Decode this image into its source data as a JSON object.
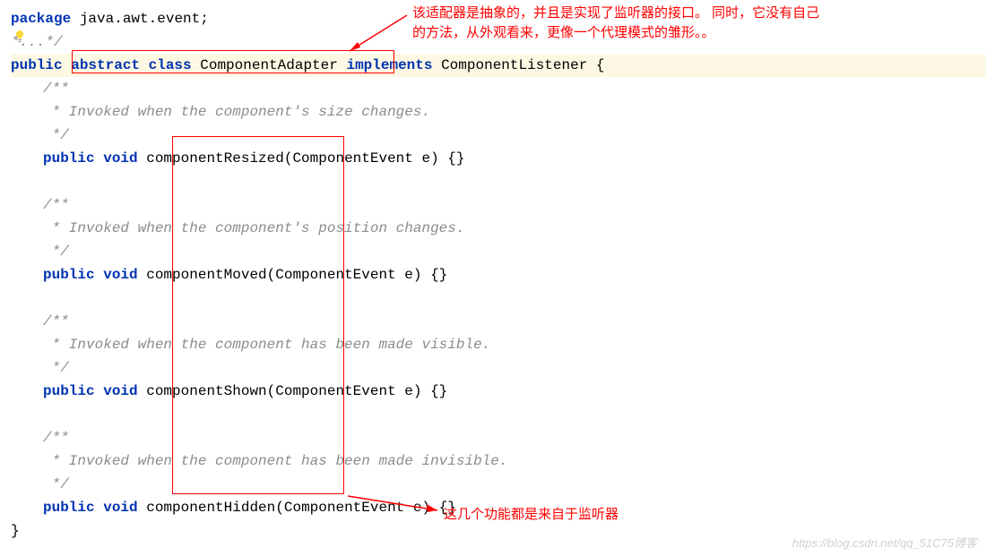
{
  "code": {
    "l1a": "package",
    "l1b": " java.awt.event;",
    "l2a": "*...*/",
    "l3a": "public",
    "l3b": " abstract class ",
    "l3c": "ComponentAdapter",
    "l3d": " implements ",
    "l3e": "ComponentListener",
    "l3f": " {",
    "c1a": "/**",
    "c1b": " * Invoked when the component's size changes.",
    "c1c": " */",
    "m1a": "public void",
    "m1b": " componentResized(",
    "m1c": "ComponentEvent",
    "m1d": " e) {}",
    "c2a": "/**",
    "c2b": " * Invoked when the component's position changes.",
    "c2c": " */",
    "m2a": "public void",
    "m2b": " componentMoved(",
    "m2c": "ComponentEvent",
    "m2d": " e) {}",
    "c3a": "/**",
    "c3b": " * Invoked when the component has been made visible.",
    "c3c": " */",
    "m3a": "public void",
    "m3b": " componentShown(",
    "m3c": "ComponentEvent",
    "m3d": " e) {}",
    "c4a": "/**",
    "c4b": " * Invoked when the component has been made invisible.",
    "c4c": " */",
    "m4a": "public void",
    "m4b": " componentHidden(",
    "m4c": "ComponentEvent",
    "m4d": " e) {}",
    "end": "}"
  },
  "annotations": {
    "top1": "该适配器是抽象的，并且是实现了监听器的接口。 同时，它没有自己",
    "top2": "的方法，从外观看来，更像一个代理模式的雏形。。",
    "bottom": "这几个功能都是来自于监听器"
  },
  "watermark": "https://blog.csdn.net/qq_51C75博客"
}
